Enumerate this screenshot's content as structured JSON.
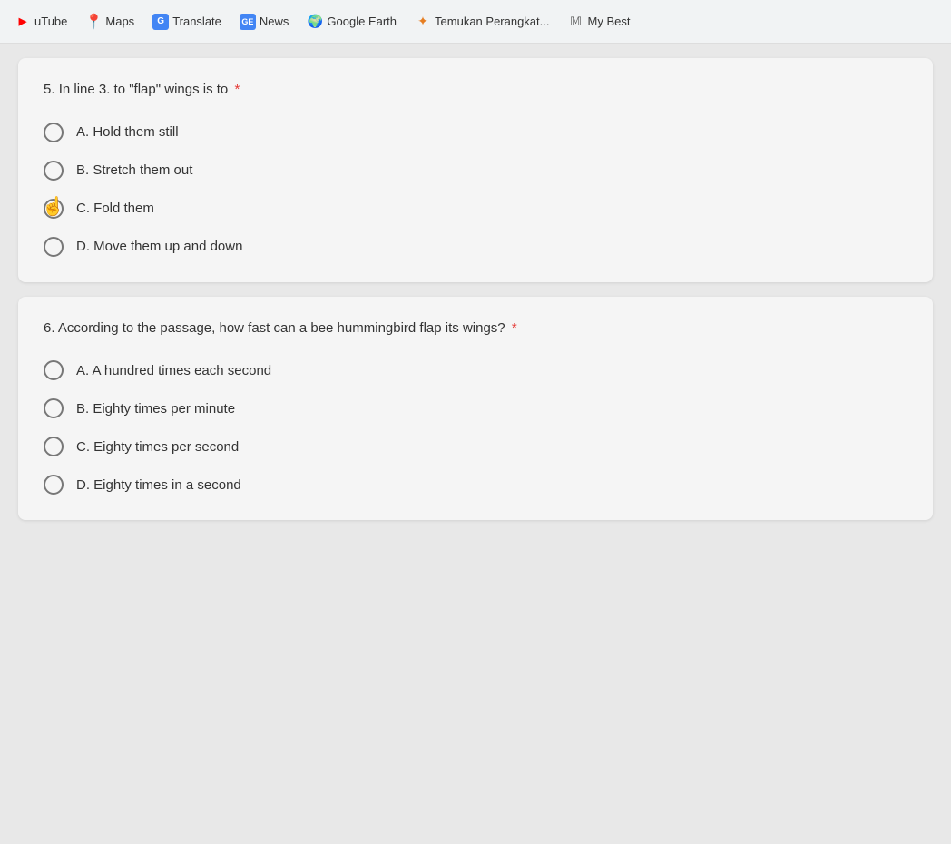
{
  "toolbar": {
    "items": [
      {
        "id": "youtube",
        "label": "uTube",
        "icon": "youtube"
      },
      {
        "id": "maps",
        "label": "Maps",
        "icon": "maps"
      },
      {
        "id": "translate",
        "label": "Translate",
        "icon": "translate"
      },
      {
        "id": "news",
        "label": "News",
        "icon": "news"
      },
      {
        "id": "earth",
        "label": "Google Earth",
        "icon": "earth"
      },
      {
        "id": "perangkat",
        "label": "Temukan Perangkat...",
        "icon": "perangkat"
      },
      {
        "id": "mybest",
        "label": "My Best",
        "icon": "mybest"
      }
    ]
  },
  "question5": {
    "number": "5.",
    "text": "In line 3. to \"flap\" wings is to",
    "required": "*",
    "options": [
      {
        "id": "q5a",
        "label": "A. Hold them still",
        "selected": false
      },
      {
        "id": "q5b",
        "label": "B. Stretch them out",
        "selected": false
      },
      {
        "id": "q5c",
        "label": "C. Fold them",
        "selected": false
      },
      {
        "id": "q5d",
        "label": "D. Move them up and down",
        "selected": false
      }
    ]
  },
  "question6": {
    "number": "6.",
    "text": "According to the passage, how fast can a bee hummingbird flap its wings?",
    "required": "*",
    "options": [
      {
        "id": "q6a",
        "label": "A. A hundred times each second",
        "selected": false
      },
      {
        "id": "q6b",
        "label": "B. Eighty times per minute",
        "selected": false
      },
      {
        "id": "q6c",
        "label": "C. Eighty times per second",
        "selected": false
      },
      {
        "id": "q6d",
        "label": "D. Eighty times in a second",
        "selected": false
      }
    ]
  }
}
